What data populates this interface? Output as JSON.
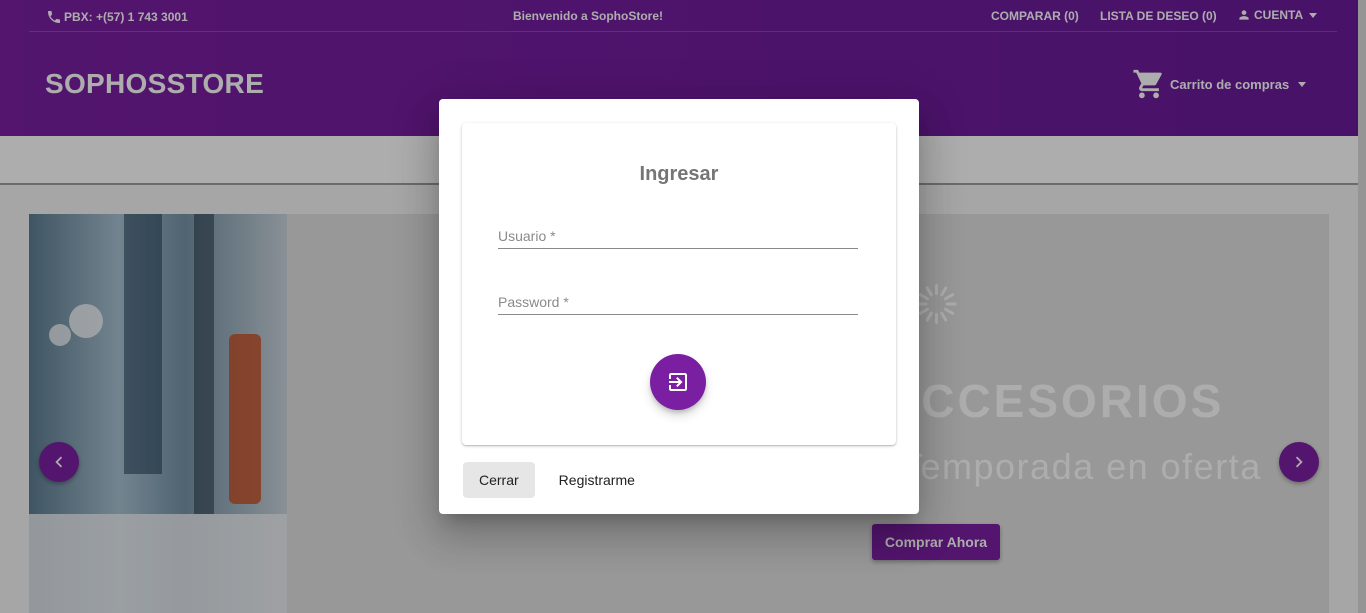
{
  "topbar": {
    "phone": "PBX: +(57) 1 743 3001",
    "welcome": "Bienvenido a SophoStore!",
    "compare": "COMPARAR (0)",
    "wishlist": "LISTA DE DESEO (0)",
    "account": "CUENTA"
  },
  "header": {
    "brand": "SOPHOSSTORE",
    "cart_label": "Carrito de compras"
  },
  "hero": {
    "title": "ACCESORIOS",
    "subtitle": "Temporada en oferta",
    "button": "Comprar Ahora"
  },
  "login_dialog": {
    "title": "Ingresar",
    "username_placeholder": "Usuario *",
    "password_placeholder": "Password *",
    "close_button": "Cerrar",
    "register_button": "Registrarme"
  },
  "colors": {
    "primary": "#7b1fa2",
    "backdrop": "rgba(0,0,0,0.32)"
  },
  "icons": {
    "phone": "phone-icon",
    "account": "person-icon",
    "cart": "shopping-cart-icon",
    "login": "login-icon",
    "prev": "chevron-left-icon",
    "next": "chevron-right-icon"
  }
}
